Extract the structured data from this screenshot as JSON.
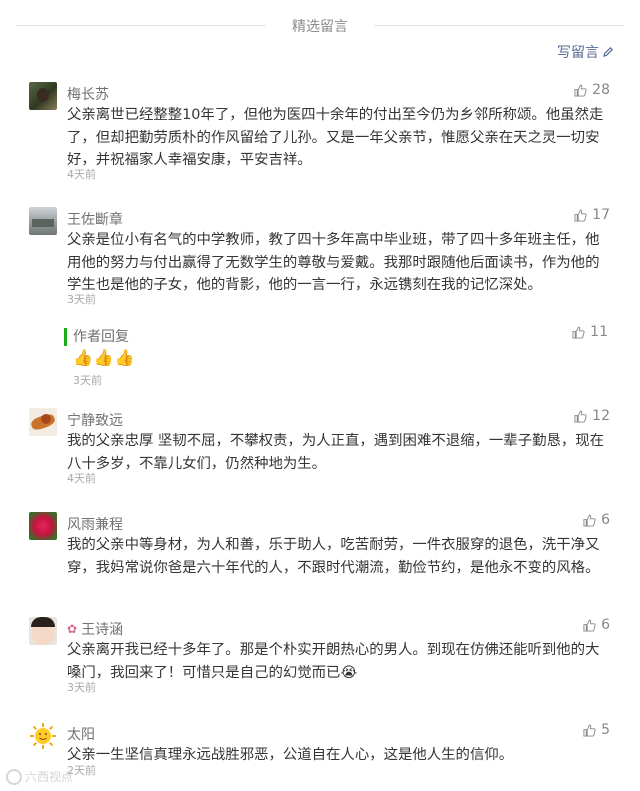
{
  "header": {
    "title": "精选留言",
    "write_label": "写留言"
  },
  "comments": [
    {
      "nick": "梅长苏",
      "likes": "28",
      "content": "父亲离世已经整整10年了，但他为医四十余年的付出至今仍为乡邻所称颂。他虽然走了，但却把勤劳质朴的作风留给了儿孙。又是一年父亲节，惟愿父亲在天之灵一切安好，并祝福家人幸福安康，平安吉祥。",
      "time": "4天前"
    },
    {
      "nick": "王佐斷章",
      "likes": "17",
      "content": "父亲是位小有名气的中学教师，教了四十多年高中毕业班，带了四十多年班主任，他用他的努力与付出赢得了无数学生的尊敬与爱戴。我那时跟随他后面读书，作为他的学生也是他的子女，他的背影，他的一言一行，永远镌刻在我的记忆深处。",
      "time": "3天前",
      "reply": {
        "title": "作者回复",
        "likes": "11",
        "emoji": [
          "👍",
          "👍",
          "👍"
        ],
        "time": "3天前"
      }
    },
    {
      "nick": "宁静致远",
      "likes": "12",
      "content": "我的父亲忠厚 坚韧不屈，不攀权责，为人正直，遇到困难不退缩，一辈子勤恳，现在八十多岁，不靠儿女们，仍然种地为生。",
      "time": "4天前"
    },
    {
      "nick": "风雨兼程",
      "likes": "6",
      "content": "我的父亲中等身材，为人和善，乐于助人，吃苦耐劳，一件衣服穿的退色，洗干净又穿，我妈常说你爸是六十年代的人，不跟时代潮流，勤俭节约，是他永不变的风格。",
      "time": ""
    },
    {
      "nick": "王诗涵",
      "nick_prefix": "✿",
      "likes": "6",
      "content": "父亲离开我已经十多年了。那是个朴实开朗热心的男人。到现在仿佛还能听到他的大嗓门，我回来了！可惜只是自己的幻觉而已",
      "content_emoji": "😭",
      "time": "3天前"
    },
    {
      "nick": "太阳",
      "likes": "5",
      "content": "父亲一生坚信真理永远战胜邪恶，公道自在人心，这是他人生的信仰。",
      "time": "2天前"
    }
  ],
  "watermark": "六西视点",
  "colors": {
    "link": "#576b95",
    "reply_bar": "#1aad19",
    "time": "#a8a8a8"
  }
}
